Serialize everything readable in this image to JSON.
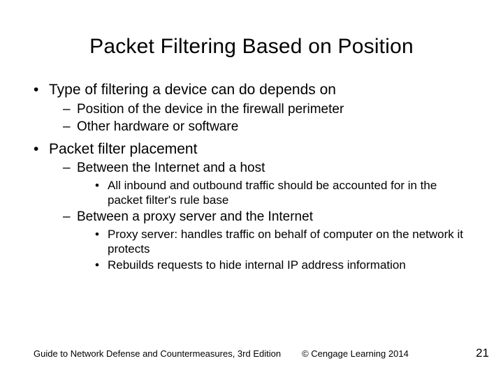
{
  "title": "Packet Filtering Based on Position",
  "b1": "Type of filtering a device can do depends on",
  "b1_s1": "Position of the device in the firewall perimeter",
  "b1_s2": "Other hardware or software",
  "b2": "Packet filter placement",
  "b2_s1": "Between the Internet and a host",
  "b2_s1_d1": "All inbound and outbound traffic should be accounted for in the packet filter's rule base",
  "b2_s2": "Between a proxy server and the Internet",
  "b2_s2_d1": "Proxy server: handles traffic on behalf of computer on the network it protects",
  "b2_s2_d2": "Rebuilds requests to hide internal IP address information",
  "footer_left": "Guide to Network Defense and Countermeasures, 3rd Edition",
  "footer_mid": "© Cengage Learning  2014",
  "footer_right": "21"
}
